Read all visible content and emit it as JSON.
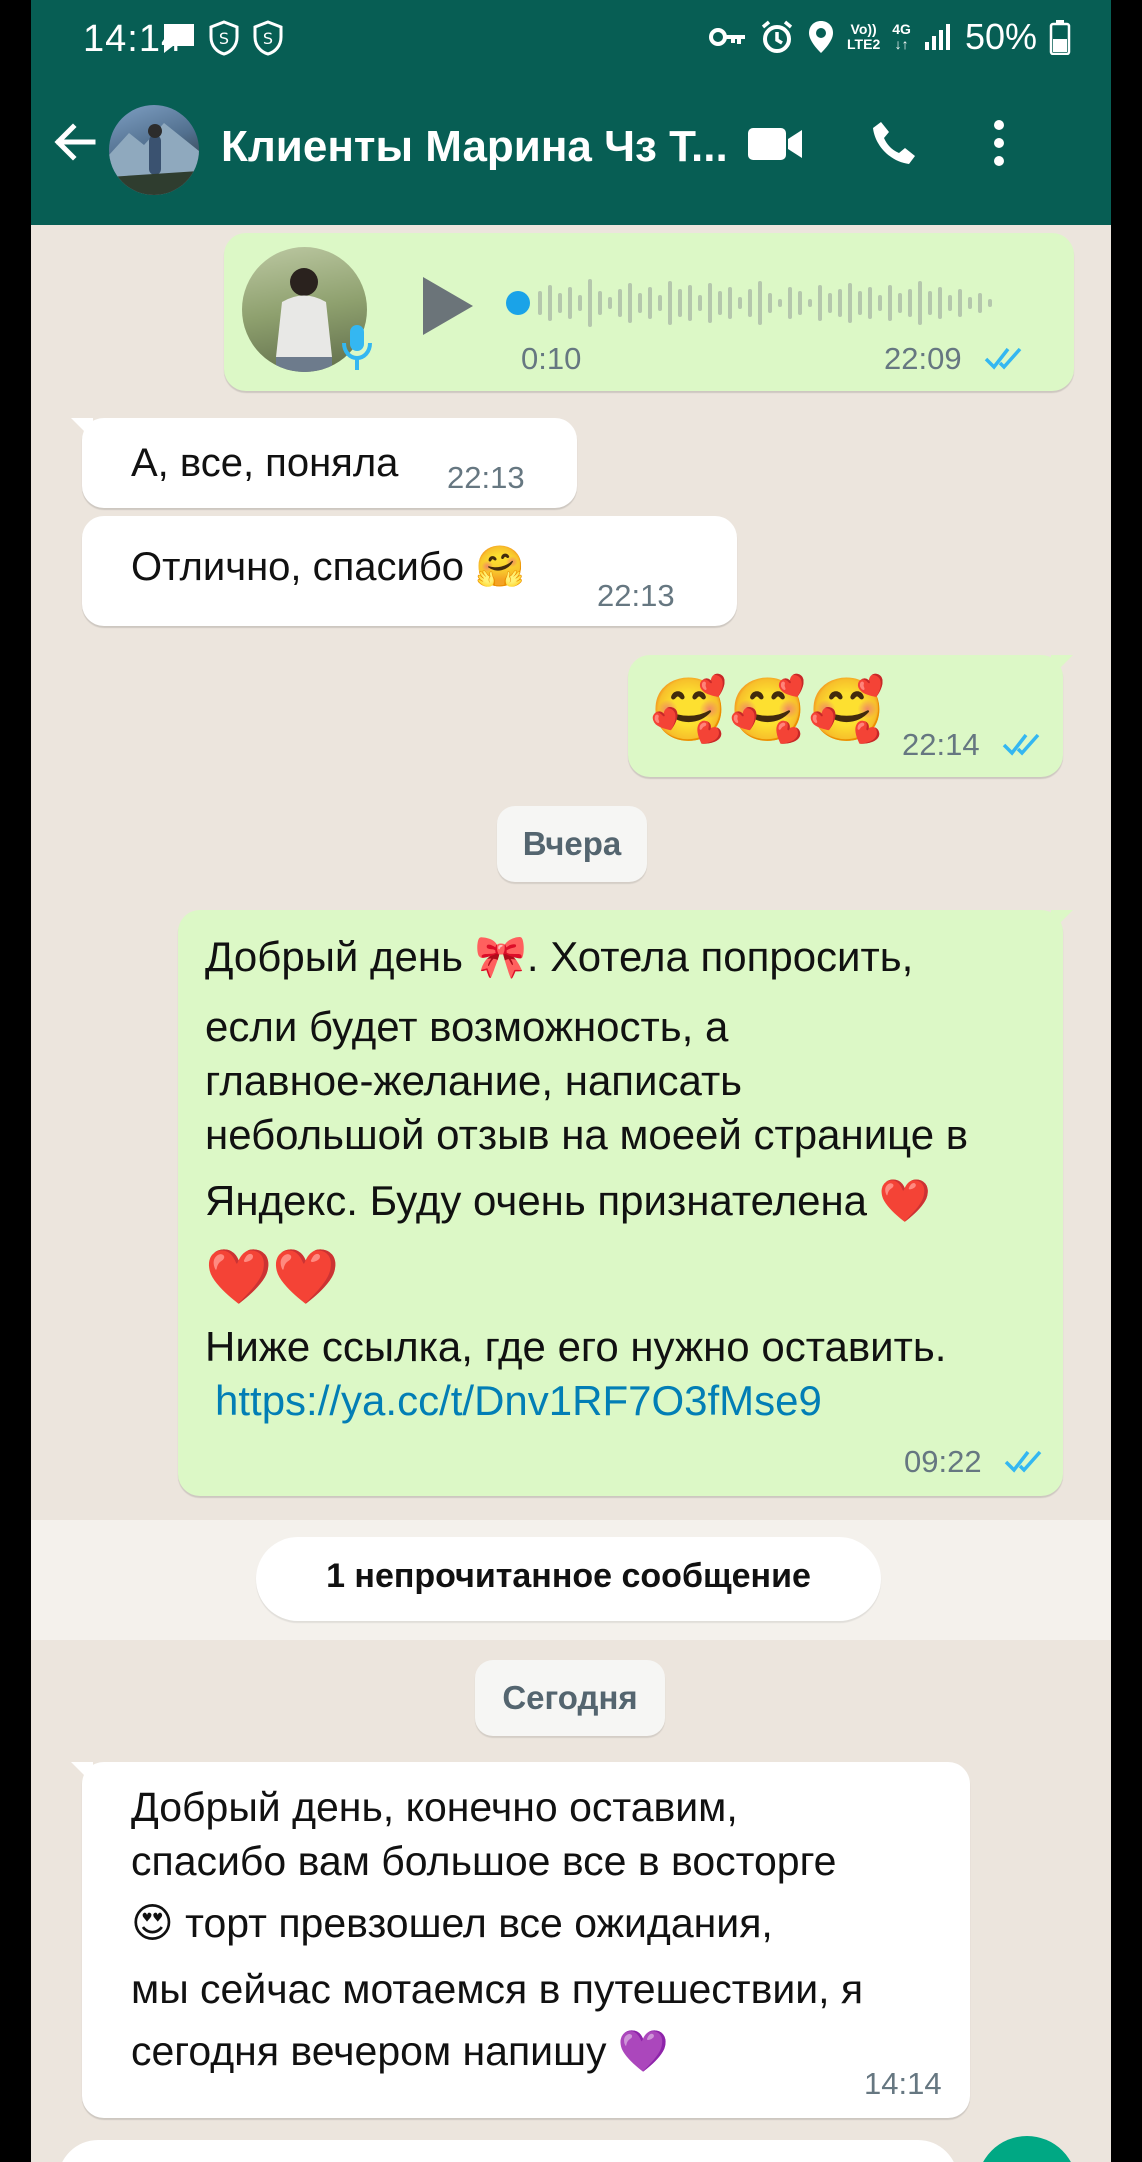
{
  "status_bar": {
    "time": "14:14",
    "battery": "50%",
    "network_top": "Vo))",
    "network_bottom": "LTE2",
    "net_type": "4G"
  },
  "header": {
    "title": "Клиенты Марина Чз Т..."
  },
  "colors": {
    "header": "#075e54",
    "outgoing": "#dcf8c6",
    "incoming": "#ffffff",
    "link": "#027eb5",
    "read_ticks": "#34b7f1"
  },
  "messages": {
    "voice": {
      "duration": "0:10",
      "time": "22:09"
    },
    "m1": {
      "text": "А, все, поняла",
      "time": "22:13"
    },
    "m2": {
      "text": "Отлично, спасибо 🤗",
      "time": "22:13"
    },
    "m3": {
      "text": "🥰🥰🥰",
      "time": "22:14"
    },
    "m5": {
      "line1": "Добрый день 🎀.  Хотела попросить,",
      "line2": "если будет возможность,  а",
      "line3": "главное-желание,  написать",
      "line4": "небольшой отзыв на моеей странице в",
      "line5": "Яндекс.  Буду очень признателена ❤️",
      "line6": "❤️❤️",
      "line7": "Ниже ссылка, где его нужно оставить.",
      "link": "https://ya.cc/t/Dnv1RF7O3fMse9",
      "time": "09:22"
    },
    "m6": {
      "line1": "Добрый день, конечно оставим,",
      "line2": "спасибо вам большое все в восторге",
      "line3": "😍 торт превзошел все ожидания,",
      "line4": "мы сейчас мотаемся в путешествии, я",
      "line5": "сегодня вечером напишу 💜",
      "time": "14:14"
    }
  },
  "date_labels": {
    "yesterday": "Вчера",
    "today": "Сегодня"
  },
  "unread_label": "1 непрочитанное сообщение"
}
